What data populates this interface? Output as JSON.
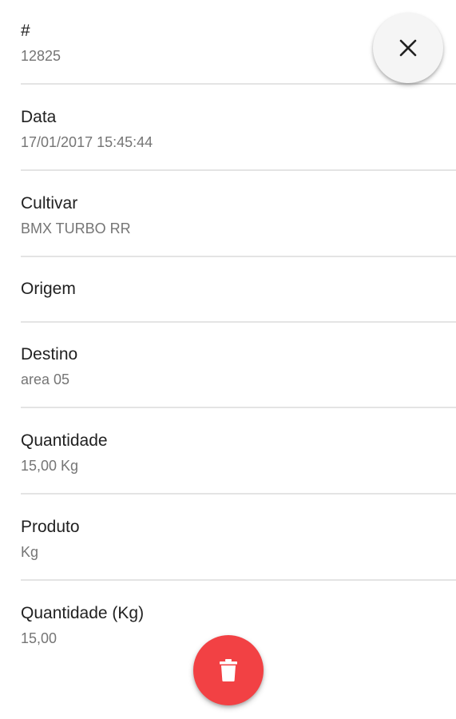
{
  "fields": [
    {
      "label": "#",
      "value": "12825"
    },
    {
      "label": "Data",
      "value": "17/01/2017 15:45:44"
    },
    {
      "label": "Cultivar",
      "value": "BMX TURBO RR"
    },
    {
      "label": "Origem",
      "value": ""
    },
    {
      "label": "Destino",
      "value": "area 05"
    },
    {
      "label": "Quantidade",
      "value": "15,00 Kg"
    },
    {
      "label": "Produto",
      "value": "Kg"
    },
    {
      "label": "Quantidade (Kg)",
      "value": "15,00"
    }
  ],
  "actions": {
    "close_icon": "close-icon",
    "delete_icon": "trash-icon"
  },
  "colors": {
    "delete_fab": "#f24144",
    "close_fab": "#f5f5f5",
    "divider": "#e4e4e4",
    "secondary_text": "#757575"
  }
}
